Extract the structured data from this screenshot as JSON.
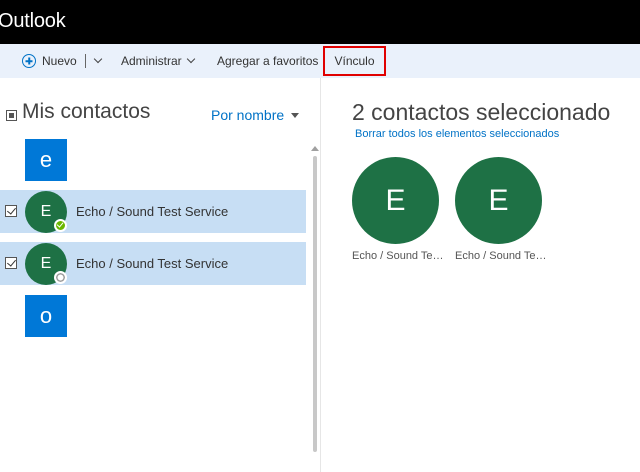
{
  "app": {
    "title": "Outlook"
  },
  "toolbar": {
    "new_label": "Nuevo",
    "manage_label": "Administrar",
    "favorites_label": "Agregar a favoritos",
    "link_label": "Vínculo"
  },
  "contacts_pane": {
    "title": "Mis contactos",
    "sort_label": "Por nombre",
    "letters": [
      "e",
      "o"
    ],
    "rows": [
      {
        "initial": "E",
        "name": "Echo / Sound Test Service",
        "checked": true,
        "presence": "online"
      },
      {
        "initial": "E",
        "name": "Echo / Sound Test Service",
        "checked": true,
        "presence": "offline"
      }
    ]
  },
  "selection_pane": {
    "title": "2 contactos seleccionado",
    "clear_label": "Borrar todos los elementos seleccionados",
    "cards": [
      {
        "initial": "E",
        "name": "Echo / Sound Test Service"
      },
      {
        "initial": "E",
        "name": "Echo / Sound Test Service"
      }
    ]
  },
  "colors": {
    "titlebar": "#000000",
    "toolbar_bg": "#eaf1fb",
    "accent_blue": "#0078d7",
    "link_blue": "#0072c6",
    "avatar_green": "#1e7145",
    "selected_row": "#c7def4",
    "highlight_red": "#e00000",
    "presence_online": "#6bb700"
  }
}
